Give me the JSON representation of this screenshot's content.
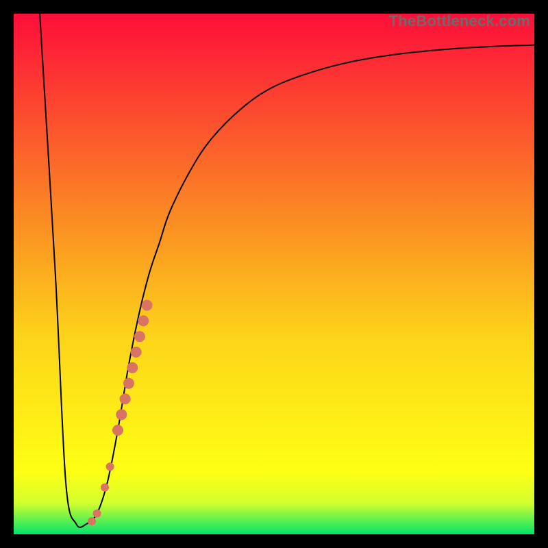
{
  "watermark": "TheBottleneck.com",
  "colors": {
    "bg_top": "#fe0e3a",
    "bg_mid1": "#fb8724",
    "bg_mid2": "#fdd41a",
    "bg_mid3": "#feff14",
    "bg_mid4": "#d3ff2e",
    "bg_bottom": "#00e46b",
    "curve_stroke": "#000000",
    "marker_fill": "#d97363",
    "frame": "#000000"
  },
  "chart_data": {
    "type": "line",
    "title": "",
    "xlabel": "",
    "ylabel": "",
    "xlim": [
      0,
      100
    ],
    "ylim": [
      0,
      100
    ],
    "grid": false,
    "legend": false,
    "series": [
      {
        "name": "curve",
        "x": [
          5,
          8,
          10,
          12,
          14,
          16,
          18,
          20,
          22,
          24,
          26,
          28,
          30,
          34,
          38,
          44,
          50,
          58,
          66,
          76,
          88,
          100
        ],
        "y": [
          100,
          50,
          10,
          2,
          2,
          4,
          10,
          20,
          32,
          42,
          50,
          56,
          62,
          70,
          76,
          82,
          86,
          89,
          91,
          92.5,
          93.5,
          94
        ]
      }
    ],
    "markers": [
      {
        "x": 15.0,
        "y": 2.5
      },
      {
        "x": 16.0,
        "y": 4.0
      },
      {
        "x": 17.5,
        "y": 9.0
      },
      {
        "x": 18.5,
        "y": 13.0
      },
      {
        "x": 20.0,
        "y": 20.0
      },
      {
        "x": 20.7,
        "y": 23.0
      },
      {
        "x": 21.4,
        "y": 26.0
      },
      {
        "x": 22.1,
        "y": 29.0
      },
      {
        "x": 22.8,
        "y": 32.0
      },
      {
        "x": 23.5,
        "y": 35.0
      },
      {
        "x": 24.2,
        "y": 38.0
      },
      {
        "x": 24.9,
        "y": 41.0
      },
      {
        "x": 25.6,
        "y": 44.0
      }
    ],
    "gradient_stops": [
      {
        "offset": 0.0,
        "color_key": "bg_top"
      },
      {
        "offset": 0.38,
        "color_key": "bg_mid1"
      },
      {
        "offset": 0.62,
        "color_key": "bg_mid2"
      },
      {
        "offset": 0.88,
        "color_key": "bg_mid3"
      },
      {
        "offset": 0.94,
        "color_key": "bg_mid4"
      },
      {
        "offset": 1.0,
        "color_key": "bg_bottom"
      }
    ]
  }
}
